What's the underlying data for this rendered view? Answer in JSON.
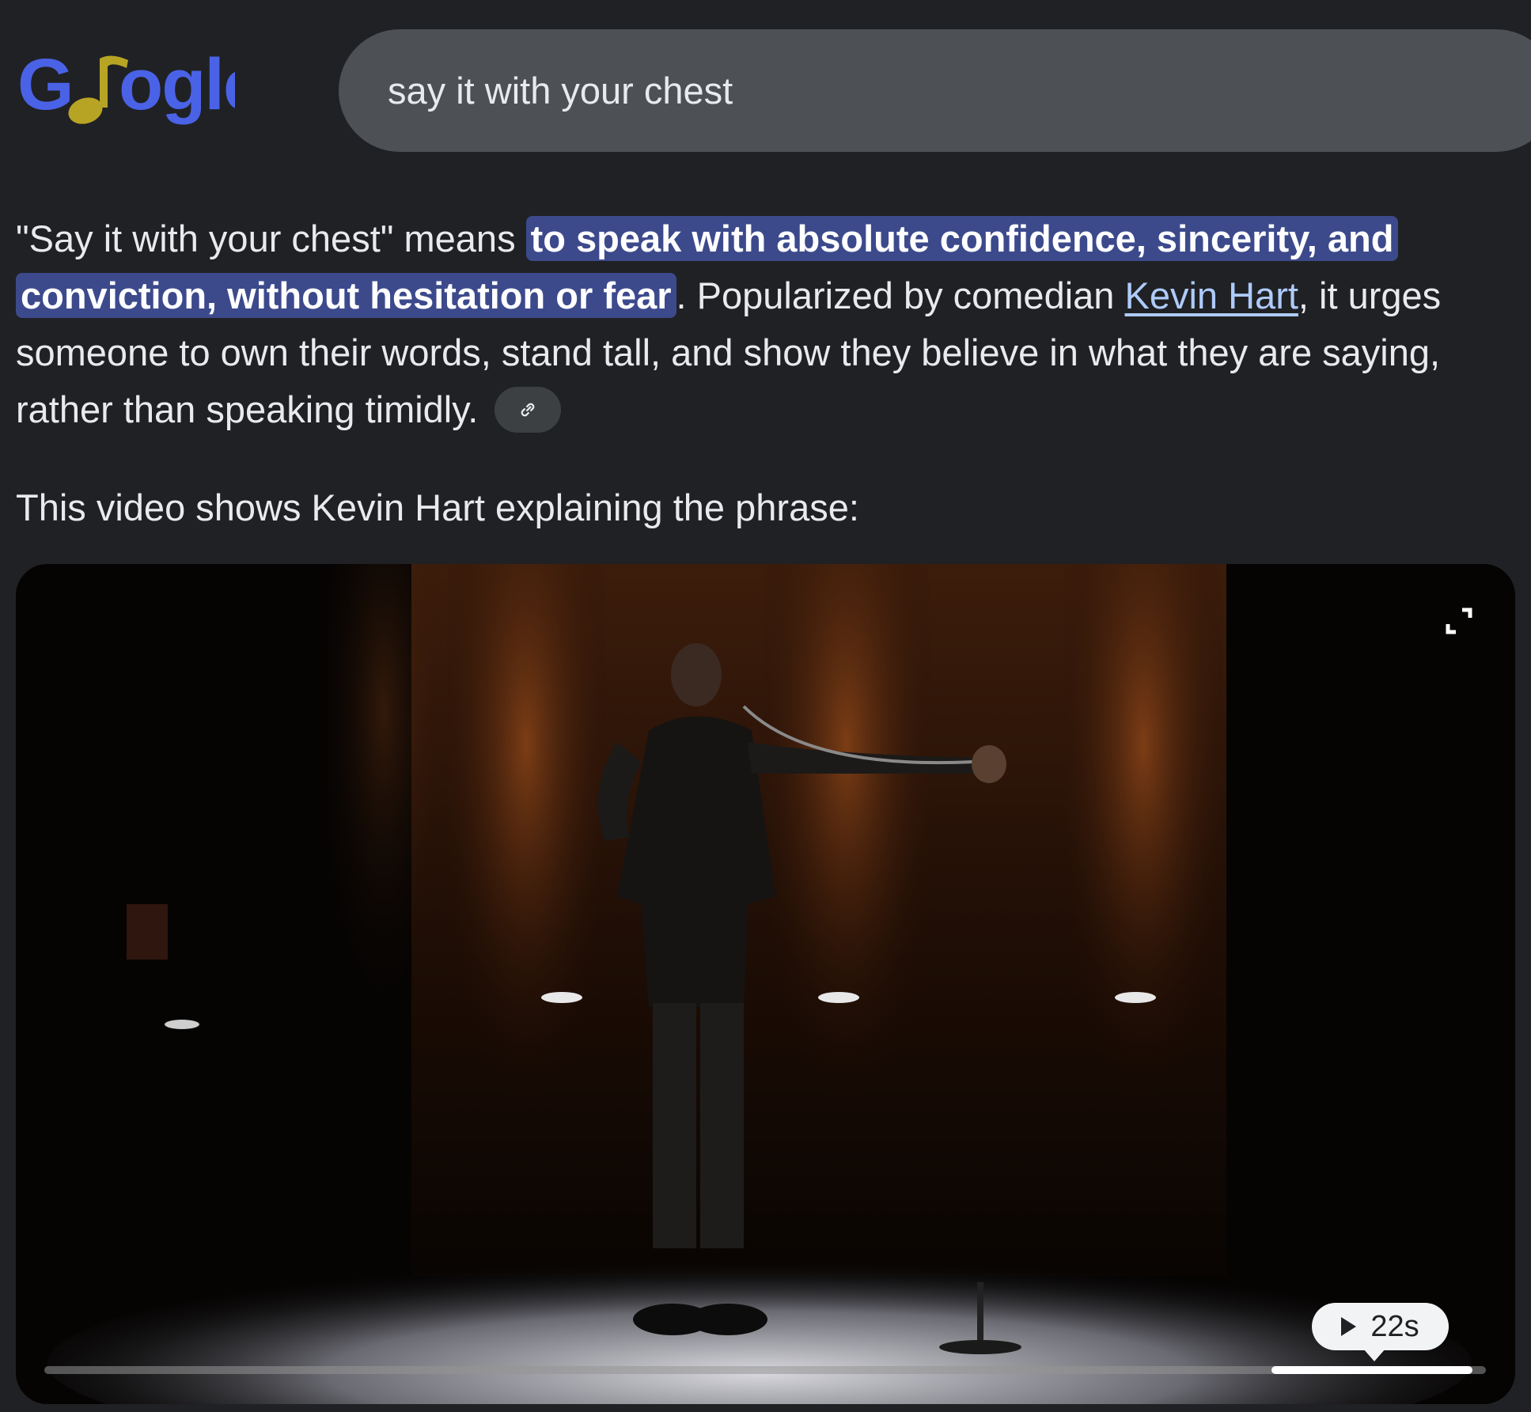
{
  "header": {
    "logo_text": "Google",
    "search_value": "say it with your chest",
    "colors": {
      "logo_blue": "#4a62e6",
      "logo_note_gold": "#b8a424"
    }
  },
  "answer": {
    "part1": "\"Say it with your chest\" means ",
    "highlight": "to speak with absolute confidence, sincerity, and conviction, without hesitation or fear",
    "part2": ". Popularized by comedian ",
    "link_text": "Kevin Hart",
    "part3": ", it urges someone to own their words, stand tall, and show they believe in what they are saying, rather than speaking timidly.",
    "link_chip_icon": "link-icon",
    "colors": {
      "highlight_bg": "#3c4a8c",
      "link": "#aecbfa"
    }
  },
  "video_intro": "This video shows Kevin Hart explaining the phrase:",
  "video": {
    "duration": "22s",
    "expand_icon": "expand-icon",
    "play_icon": "play-icon"
  }
}
